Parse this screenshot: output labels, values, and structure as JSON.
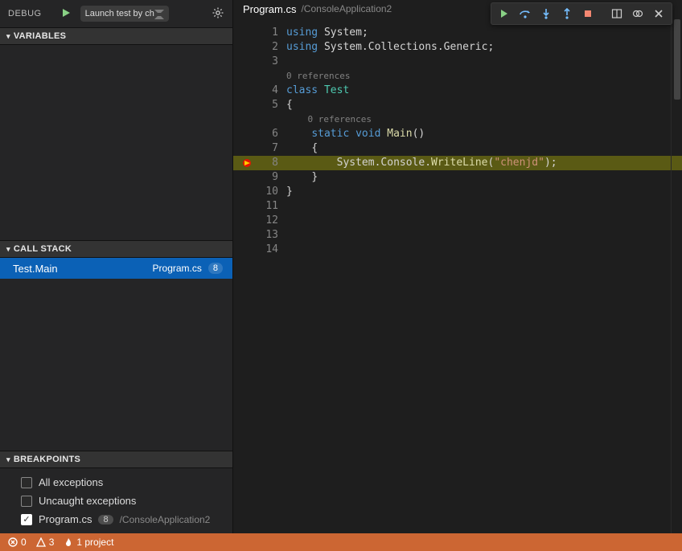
{
  "debug": {
    "title": "DEBUG",
    "launch_label": "Launch test by ch"
  },
  "variables": {
    "title": "VARIABLES"
  },
  "callstack": {
    "title": "CALL STACK",
    "frame": "Test.Main",
    "file": "Program.cs",
    "line": "8"
  },
  "breakpoints": {
    "title": "BREAKPOINTS",
    "all_exceptions": "All exceptions",
    "uncaught_exceptions": "Uncaught exceptions",
    "file": "Program.cs",
    "file_line": "8",
    "file_path": "/ConsoleApplication2"
  },
  "editor": {
    "filename": "Program.cs",
    "path": "/ConsoleApplication2"
  },
  "codelens": {
    "refs0": "0 references"
  },
  "code": {
    "kw_using": "using",
    "ns_system": "System",
    "ns_generic": "System.Collections.Generic",
    "kw_class": "class",
    "cls_test": "Test",
    "kw_static": "static",
    "kw_void": "void",
    "fn_main": "Main",
    "call_path": "System.Console.",
    "call_fn": "WriteLine",
    "str": "\"chenjd\"",
    "brace_o": "{",
    "brace_c": "}",
    "paren": "()",
    "semi": ";"
  },
  "lines": {
    "l1": "1",
    "l2": "2",
    "l3": "3",
    "l4": "4",
    "l5": "5",
    "l6": "6",
    "l7": "7",
    "l8": "8",
    "l9": "9",
    "l10": "10",
    "l11": "11",
    "l12": "12",
    "l13": "13",
    "l14": "14"
  },
  "status": {
    "errors": "0",
    "warnings": "3",
    "projects": "1 project"
  }
}
